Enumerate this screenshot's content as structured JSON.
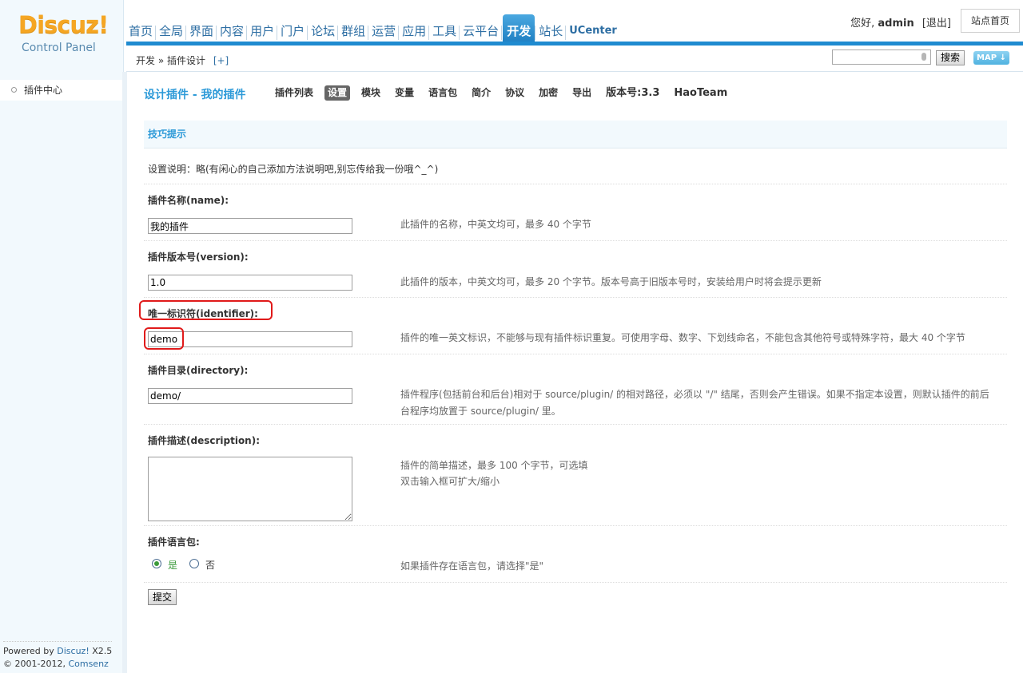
{
  "brand": {
    "logo": "Discuz!",
    "subtitle": "Control Panel"
  },
  "topnav": [
    "首页",
    "全局",
    "界面",
    "内容",
    "用户",
    "门户",
    "论坛",
    "群组",
    "运营",
    "应用",
    "工具",
    "云平台",
    "开发",
    "站长",
    "UCenter"
  ],
  "topnav_active": "开发",
  "user": {
    "greeting": "您好,",
    "name": "admin",
    "logout": "[退出]",
    "site_home": "站点首页"
  },
  "breadcrumb": {
    "path": "开发 » 插件设计",
    "add": "[+]"
  },
  "search": {
    "placeholder": "",
    "button": "搜索",
    "map": "MAP"
  },
  "sidebar": {
    "items": [
      {
        "label": "插件中心"
      }
    ]
  },
  "footer": {
    "powered_prefix": "Powered by",
    "powered_link": "Discuz!",
    "version": "X2.5",
    "copyright_prefix": "© 2001-2012,",
    "copyright_link": "Comsenz Inc."
  },
  "page": {
    "title": "设计插件 - 我的插件",
    "tabs": [
      "插件列表",
      "设置",
      "模块",
      "变量",
      "语言包",
      "简介",
      "协议",
      "加密",
      "导出",
      "版本号:3.3",
      "HaoTeam"
    ],
    "active_tab": "设置"
  },
  "tips": {
    "heading": "技巧提示",
    "text": "设置说明：略(有闲心的自己添加方法说明吧,别忘传给我一份哦^_^)"
  },
  "form": {
    "name": {
      "label": "插件名称(name):",
      "value": "我的插件",
      "hint": "此插件的名称，中英文均可，最多 40 个字节"
    },
    "version": {
      "label": "插件版本号(version):",
      "value": "1.0",
      "hint": "此插件的版本，中英文均可，最多 20 个字节。版本号高于旧版本号时，安装给用户时将会提示更新"
    },
    "identifier": {
      "label": "唯一标识符(identifier):",
      "value": "demo",
      "hint": "插件的唯一英文标识，不能够与现有插件标识重复。可使用字母、数字、下划线命名，不能包含其他符号或特殊字符，最大 40 个字节"
    },
    "directory": {
      "label": "插件目录(directory):",
      "value": "demo/",
      "hint1": "插件程序(包括前台和后台)相对于 source/plugin/ 的相对路径，必须以 \"/\" 结尾，否则会产生错误。如果不指定本设置，则默认插件的前后",
      "hint2": "台程序均放置于 source/plugin/ 里。"
    },
    "description": {
      "label": "插件描述(description):",
      "value": "",
      "hint1": "插件的简单描述，最多 100 个字节，可选填",
      "hint2": "双击输入框可扩大/缩小"
    },
    "langpack": {
      "label": "插件语言包:",
      "yes": "是",
      "no": "否",
      "selected": "是",
      "hint": "如果插件存在语言包，请选择\"是\""
    },
    "submit": "提交"
  },
  "colors": {
    "accent": "#1f8bd0",
    "title_blue": "#2d9ad8",
    "highlight": "#e01a1a",
    "logo": "#f5a623"
  }
}
